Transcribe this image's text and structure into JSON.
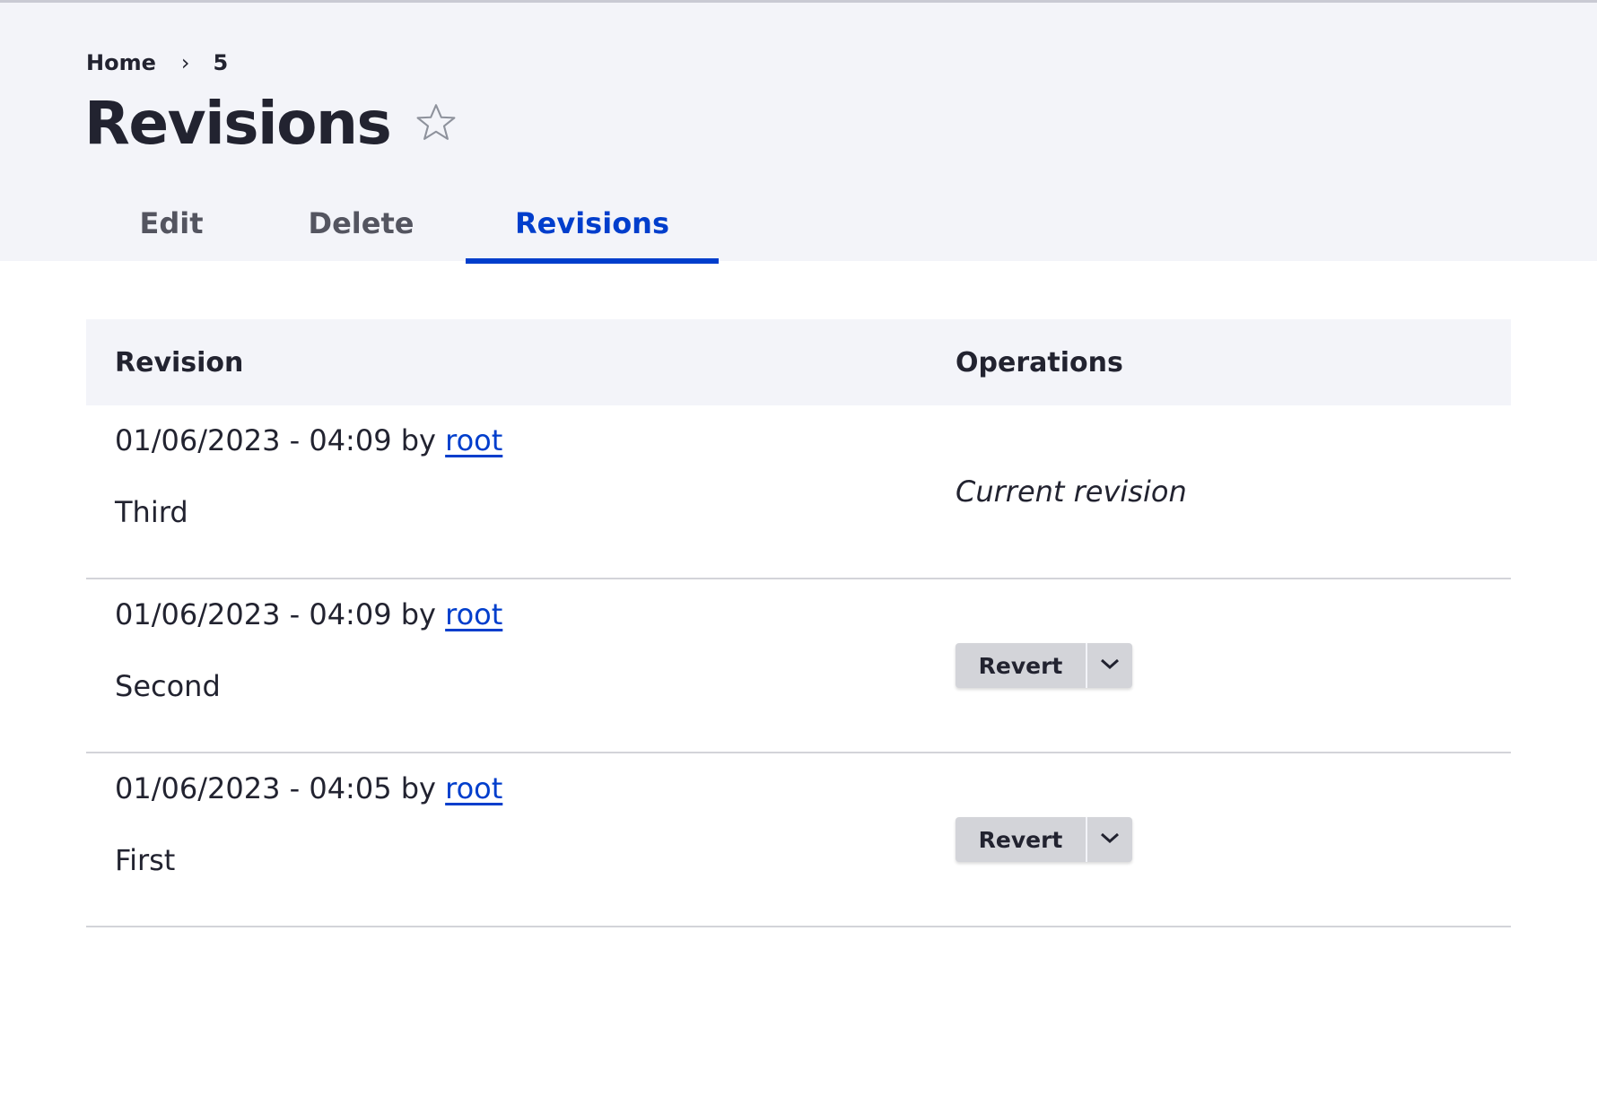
{
  "breadcrumb": {
    "home": "Home",
    "separator": "›",
    "current": "5"
  },
  "page": {
    "title": "Revisions",
    "favorite_icon": "star-outline-icon"
  },
  "tabs": [
    {
      "label": "Edit",
      "active": false
    },
    {
      "label": "Delete",
      "active": false
    },
    {
      "label": "Revisions",
      "active": true
    }
  ],
  "table": {
    "headers": {
      "revision": "Revision",
      "operations": "Operations"
    },
    "rows": [
      {
        "date": "01/06/2023 - 04:09",
        "by": "by",
        "author": "root",
        "message": "Third",
        "operation": "Current revision"
      },
      {
        "date": "01/06/2023 - 04:09",
        "by": "by",
        "author": "root",
        "message": "Second",
        "operation": "Revert"
      },
      {
        "date": "01/06/2023 - 04:05",
        "by": "by",
        "author": "root",
        "message": "First",
        "operation": "Revert"
      }
    ]
  },
  "colors": {
    "accent": "#003ecc",
    "header_bg": "#f3f4f9",
    "button_bg": "#d3d4d9"
  }
}
